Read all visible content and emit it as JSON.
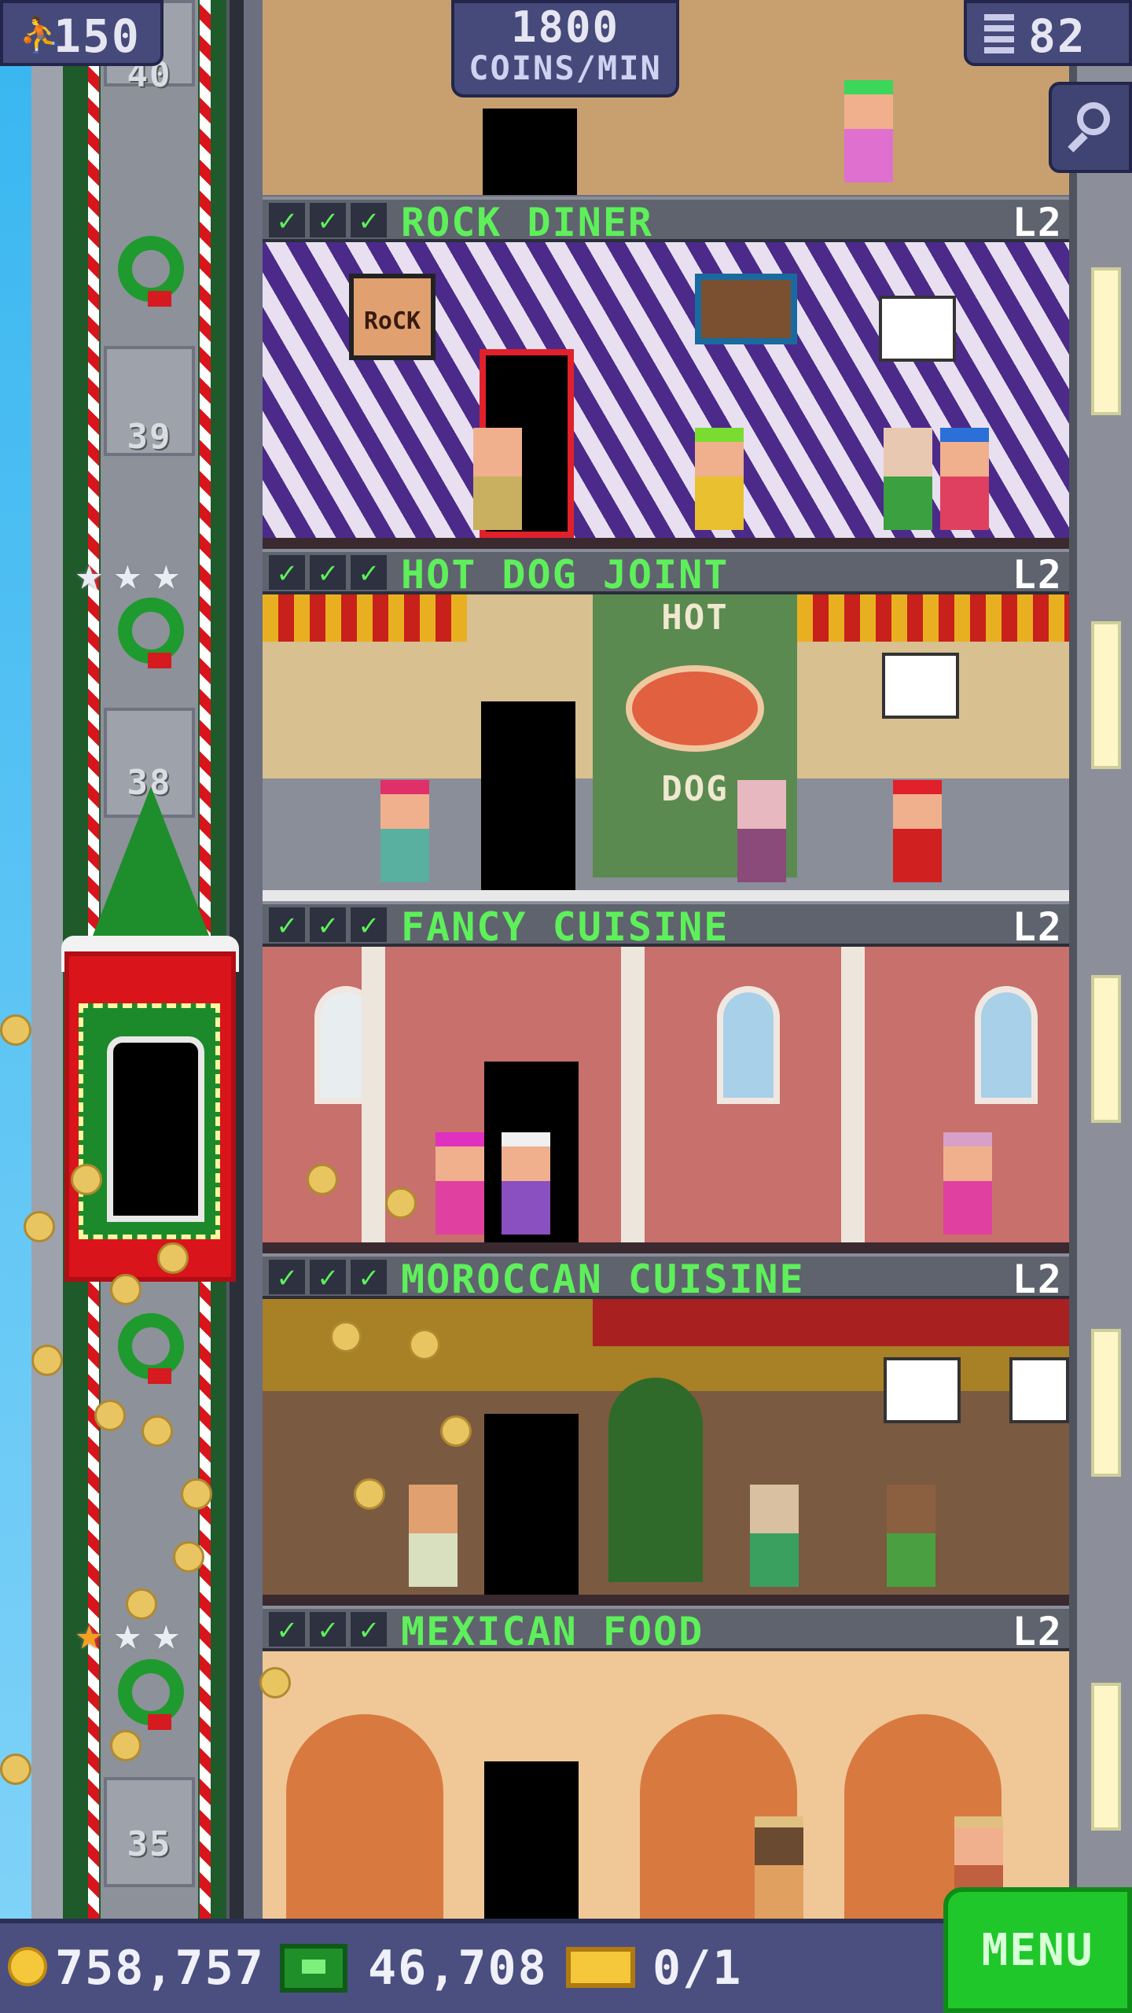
{
  "hud": {
    "population": "150",
    "rate_value": "1800",
    "rate_unit": "COINS/MIN",
    "floors": "82"
  },
  "elevator_floors": [
    "40",
    "39",
    "38",
    "35"
  ],
  "floors": [
    {
      "name": "ROCK DINER",
      "level": "L2",
      "checks": 3
    },
    {
      "name": "HOT DOG JOINT",
      "level": "L2",
      "checks": 3
    },
    {
      "name": "FANCY CUISINE",
      "level": "L2",
      "checks": 3
    },
    {
      "name": "MOROCCAN CUISINE",
      "level": "L2",
      "checks": 3
    },
    {
      "name": "MEXICAN FOOD",
      "level": "L2",
      "checks": 3
    }
  ],
  "room_signs": {
    "hotdog_top": "HOT",
    "hotdog_bottom": "DOG",
    "rock_sign": "RoCK"
  },
  "bottom_bar": {
    "coins": "758,757",
    "bux": "46,708",
    "tickets": "0/1",
    "menu_label": "MENU"
  },
  "colors": {
    "accent_green": "#5ef05a",
    "hud_bg": "#454a7a",
    "menu_green": "#1fc72a"
  }
}
